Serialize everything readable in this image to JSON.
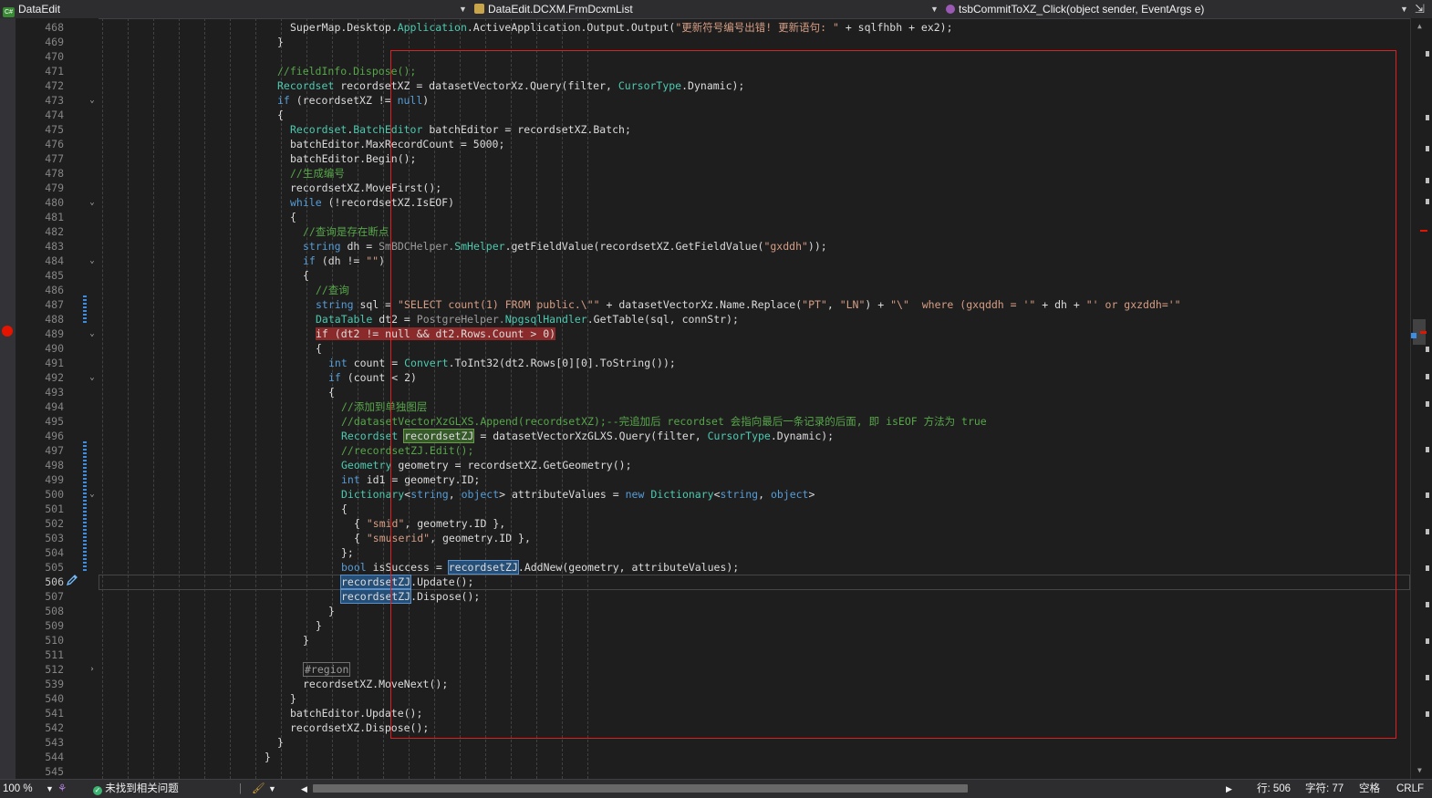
{
  "nav": {
    "project_badge": "C#",
    "project": "DataEdit",
    "class_badge": "",
    "class": "DataEdit.DCXM.FrmDcxmList",
    "member": "tsbCommitToXZ_Click(object sender, EventArgs e)",
    "pin": "⇲"
  },
  "colors": {
    "keyword": "#569cd6",
    "type": "#4ec9b0",
    "string": "#d69d85",
    "comment": "#57a64a",
    "highlight_box": "#e02020",
    "breakpoint": "#e51400"
  },
  "breakpoint_line": "489",
  "current_line": "506",
  "code_lines": [
    {
      "n": "468",
      "indent": 15,
      "fold": "",
      "segs": [
        [
          "SuperMap.Desktop.",
          "p"
        ],
        [
          "Application",
          "t"
        ],
        [
          ".ActiveApplication.Output.Output(",
          "p"
        ],
        [
          "\"更新符号编号出错! 更新语句: \"",
          "s"
        ],
        [
          " + sqlfhbh + ex2);",
          "p"
        ]
      ]
    },
    {
      "n": "469",
      "indent": 14,
      "fold": "",
      "segs": [
        [
          "}",
          "p"
        ]
      ]
    },
    {
      "n": "470",
      "indent": 0,
      "fold": "",
      "segs": []
    },
    {
      "n": "471",
      "indent": 14,
      "fold": "",
      "segs": [
        [
          "//fieldInfo.Dispose();",
          "c"
        ]
      ]
    },
    {
      "n": "472",
      "indent": 14,
      "fold": "",
      "segs": [
        [
          "Recordset",
          "t"
        ],
        [
          " recordsetXZ = datasetVectorXz.Query(filter, ",
          "p"
        ],
        [
          "CursorType",
          "t"
        ],
        [
          ".Dynamic);",
          "p"
        ]
      ]
    },
    {
      "n": "473",
      "indent": 14,
      "fold": "v",
      "segs": [
        [
          "if",
          "k"
        ],
        [
          " (recordsetXZ != ",
          "p"
        ],
        [
          "null",
          "k"
        ],
        [
          ")",
          "p"
        ]
      ]
    },
    {
      "n": "474",
      "indent": 14,
      "fold": "",
      "segs": [
        [
          "{",
          "p"
        ]
      ]
    },
    {
      "n": "475",
      "indent": 15,
      "fold": "",
      "segs": [
        [
          "Recordset",
          "t"
        ],
        [
          ".",
          "p"
        ],
        [
          "BatchEditor",
          "t"
        ],
        [
          " batchEditor = recordsetXZ.Batch;",
          "p"
        ]
      ]
    },
    {
      "n": "476",
      "indent": 15,
      "fold": "",
      "segs": [
        [
          "batchEditor.MaxRecordCount = 5000;",
          "p"
        ]
      ]
    },
    {
      "n": "477",
      "indent": 15,
      "fold": "",
      "segs": [
        [
          "batchEditor.Begin();",
          "p"
        ]
      ]
    },
    {
      "n": "478",
      "indent": 15,
      "fold": "",
      "segs": [
        [
          "//生成编号",
          "c"
        ]
      ]
    },
    {
      "n": "479",
      "indent": 15,
      "fold": "",
      "segs": [
        [
          "recordsetXZ.MoveFirst();",
          "p"
        ]
      ]
    },
    {
      "n": "480",
      "indent": 15,
      "fold": "v",
      "segs": [
        [
          "while",
          "k"
        ],
        [
          " (!recordsetXZ.IsEOF)",
          "p"
        ]
      ]
    },
    {
      "n": "481",
      "indent": 15,
      "fold": "",
      "segs": [
        [
          "{",
          "p"
        ]
      ]
    },
    {
      "n": "482",
      "indent": 16,
      "fold": "",
      "segs": [
        [
          "//查询是存在断点",
          "c"
        ]
      ]
    },
    {
      "n": "483",
      "indent": 16,
      "fold": "",
      "segs": [
        [
          "string",
          "k"
        ],
        [
          " dh = ",
          "p"
        ],
        [
          "SmBDCHelper.",
          "d"
        ],
        [
          "SmHelper",
          "t"
        ],
        [
          ".getFieldValue(recordsetXZ.GetFieldValue(",
          "p"
        ],
        [
          "\"gxddh\"",
          "s"
        ],
        [
          "));",
          "p"
        ]
      ]
    },
    {
      "n": "484",
      "indent": 16,
      "fold": "v",
      "segs": [
        [
          "if",
          "k"
        ],
        [
          " (dh != ",
          "p"
        ],
        [
          "\"\"",
          "s"
        ],
        [
          ")",
          "p"
        ]
      ]
    },
    {
      "n": "485",
      "indent": 16,
      "fold": "",
      "segs": [
        [
          "{",
          "p"
        ]
      ]
    },
    {
      "n": "486",
      "indent": 17,
      "fold": "",
      "segs": [
        [
          "//查询",
          "c"
        ]
      ]
    },
    {
      "n": "487",
      "indent": 17,
      "fold": "",
      "segs": [
        [
          "string",
          "k"
        ],
        [
          " sql = ",
          "p"
        ],
        [
          "\"SELECT count(1) FROM public.\\\"\"",
          "s"
        ],
        [
          " + datasetVectorXz.Name.Replace(",
          "p"
        ],
        [
          "\"PT\"",
          "s"
        ],
        [
          ", ",
          "p"
        ],
        [
          "\"LN\"",
          "s"
        ],
        [
          ") + ",
          "p"
        ],
        [
          "\"\\\"  where (gxqddh = '\"",
          "s"
        ],
        [
          " + dh + ",
          "p"
        ],
        [
          "\"' or gxzddh='\"",
          "s"
        ]
      ]
    },
    {
      "n": "488",
      "indent": 17,
      "fold": "",
      "segs": [
        [
          "DataTable",
          "t"
        ],
        [
          " dt2 = ",
          "p"
        ],
        [
          "PostgreHelper.",
          "d"
        ],
        [
          "NpgsqlHandler",
          "t"
        ],
        [
          ".GetTable(sql, connStr);",
          "p"
        ]
      ]
    },
    {
      "n": "489",
      "indent": 17,
      "fold": "v",
      "segs": [
        [
          "if (dt2 != null && dt2.Rows.Count > 0)",
          "b"
        ]
      ]
    },
    {
      "n": "490",
      "indent": 17,
      "fold": "",
      "segs": [
        [
          "{",
          "p"
        ]
      ]
    },
    {
      "n": "491",
      "indent": 18,
      "fold": "",
      "segs": [
        [
          "int",
          "k"
        ],
        [
          " count = ",
          "p"
        ],
        [
          "Convert",
          "t"
        ],
        [
          ".ToInt32(dt2.Rows[0][0].ToString());",
          "p"
        ]
      ]
    },
    {
      "n": "492",
      "indent": 18,
      "fold": "v",
      "segs": [
        [
          "if",
          "k"
        ],
        [
          " (count < 2)",
          "p"
        ]
      ]
    },
    {
      "n": "493",
      "indent": 18,
      "fold": "",
      "segs": [
        [
          "{",
          "p"
        ]
      ]
    },
    {
      "n": "494",
      "indent": 19,
      "fold": "",
      "segs": [
        [
          "//添加到单独图层",
          "c"
        ]
      ]
    },
    {
      "n": "495",
      "indent": 19,
      "fold": "",
      "segs": [
        [
          "//datasetVectorXzGLXS.Append(recordsetXZ);--完追加后 recordset 会指向最后一条记录的后面, 即 isEOF 方法为 true",
          "c"
        ]
      ]
    },
    {
      "n": "496",
      "indent": 19,
      "fold": "",
      "segs": [
        [
          "Recordset",
          "t"
        ],
        [
          " ",
          "p"
        ],
        [
          "recordsetZJ",
          "g"
        ],
        [
          " = datasetVectorXzGLXS.Query(filter, ",
          "p"
        ],
        [
          "CursorType",
          "t"
        ],
        [
          ".Dynamic);",
          "p"
        ]
      ]
    },
    {
      "n": "497",
      "indent": 19,
      "fold": "",
      "segs": [
        [
          "//recordsetZJ.Edit();",
          "c"
        ]
      ]
    },
    {
      "n": "498",
      "indent": 19,
      "fold": "",
      "segs": [
        [
          "Geometry",
          "t"
        ],
        [
          " geometry = recordsetXZ.GetGeometry();",
          "p"
        ]
      ]
    },
    {
      "n": "499",
      "indent": 19,
      "fold": "",
      "segs": [
        [
          "int",
          "k"
        ],
        [
          " id1 = geometry.ID;",
          "p"
        ]
      ]
    },
    {
      "n": "500",
      "indent": 19,
      "fold": "v",
      "segs": [
        [
          "Dictionary",
          "t"
        ],
        [
          "<",
          "p"
        ],
        [
          "string",
          "k"
        ],
        [
          ", ",
          "p"
        ],
        [
          "object",
          "k"
        ],
        [
          "> attributeValues = ",
          "p"
        ],
        [
          "new",
          "k"
        ],
        [
          " ",
          "p"
        ],
        [
          "Dictionary",
          "t"
        ],
        [
          "<",
          "p"
        ],
        [
          "string",
          "k"
        ],
        [
          ", ",
          "p"
        ],
        [
          "object",
          "k"
        ],
        [
          ">",
          "p"
        ]
      ]
    },
    {
      "n": "501",
      "indent": 19,
      "fold": "",
      "segs": [
        [
          "{",
          "p"
        ]
      ]
    },
    {
      "n": "502",
      "indent": 20,
      "fold": "",
      "segs": [
        [
          "{ ",
          "p"
        ],
        [
          "\"smid\"",
          "s"
        ],
        [
          ", geometry.ID },",
          "p"
        ]
      ]
    },
    {
      "n": "503",
      "indent": 20,
      "fold": "",
      "segs": [
        [
          "{ ",
          "p"
        ],
        [
          "\"smuserid\"",
          "s"
        ],
        [
          ", geometry.ID },",
          "p"
        ]
      ]
    },
    {
      "n": "504",
      "indent": 19,
      "fold": "",
      "segs": [
        [
          "};",
          "p"
        ]
      ]
    },
    {
      "n": "505",
      "indent": 19,
      "fold": "",
      "segs": [
        [
          "bool",
          "k"
        ],
        [
          " isSuccess = ",
          "p"
        ],
        [
          "recordsetZJ",
          "h"
        ],
        [
          ".AddNew(geometry, attributeValues);",
          "p"
        ]
      ]
    },
    {
      "n": "506",
      "indent": 19,
      "fold": "",
      "segs": [
        [
          "recordsetZJ",
          "h"
        ],
        [
          ".Update();",
          "p"
        ]
      ]
    },
    {
      "n": "507",
      "indent": 19,
      "fold": "",
      "segs": [
        [
          "recordsetZJ",
          "h"
        ],
        [
          ".Dispose();",
          "p"
        ]
      ]
    },
    {
      "n": "508",
      "indent": 18,
      "fold": "",
      "segs": [
        [
          "}",
          "p"
        ]
      ]
    },
    {
      "n": "509",
      "indent": 17,
      "fold": "",
      "segs": [
        [
          "}",
          "p"
        ]
      ]
    },
    {
      "n": "510",
      "indent": 16,
      "fold": "",
      "segs": [
        [
          "}",
          "p"
        ]
      ]
    },
    {
      "n": "511",
      "indent": 0,
      "fold": "",
      "segs": []
    },
    {
      "n": "512",
      "indent": 16,
      "fold": ">",
      "segs": [
        [
          "#region",
          "r"
        ]
      ]
    },
    {
      "n": "539",
      "indent": 16,
      "fold": "",
      "segs": [
        [
          "recordsetXZ.MoveNext();",
          "p"
        ]
      ]
    },
    {
      "n": "540",
      "indent": 15,
      "fold": "",
      "segs": [
        [
          "}",
          "p"
        ]
      ]
    },
    {
      "n": "541",
      "indent": 15,
      "fold": "",
      "segs": [
        [
          "batchEditor.Update();",
          "p"
        ]
      ]
    },
    {
      "n": "542",
      "indent": 15,
      "fold": "",
      "segs": [
        [
          "recordsetXZ.Dispose();",
          "p"
        ]
      ]
    },
    {
      "n": "543",
      "indent": 14,
      "fold": "",
      "segs": [
        [
          "}",
          "p"
        ]
      ]
    },
    {
      "n": "544",
      "indent": 13,
      "fold": "",
      "segs": [
        [
          "}",
          "p"
        ]
      ]
    },
    {
      "n": "545",
      "indent": 0,
      "fold": "",
      "segs": []
    }
  ],
  "status": {
    "zoom": "100 %",
    "issues": "未找到相关问题",
    "line": "行: 506",
    "char": "字符: 77",
    "spaces": "空格",
    "eol": "CRLF"
  }
}
